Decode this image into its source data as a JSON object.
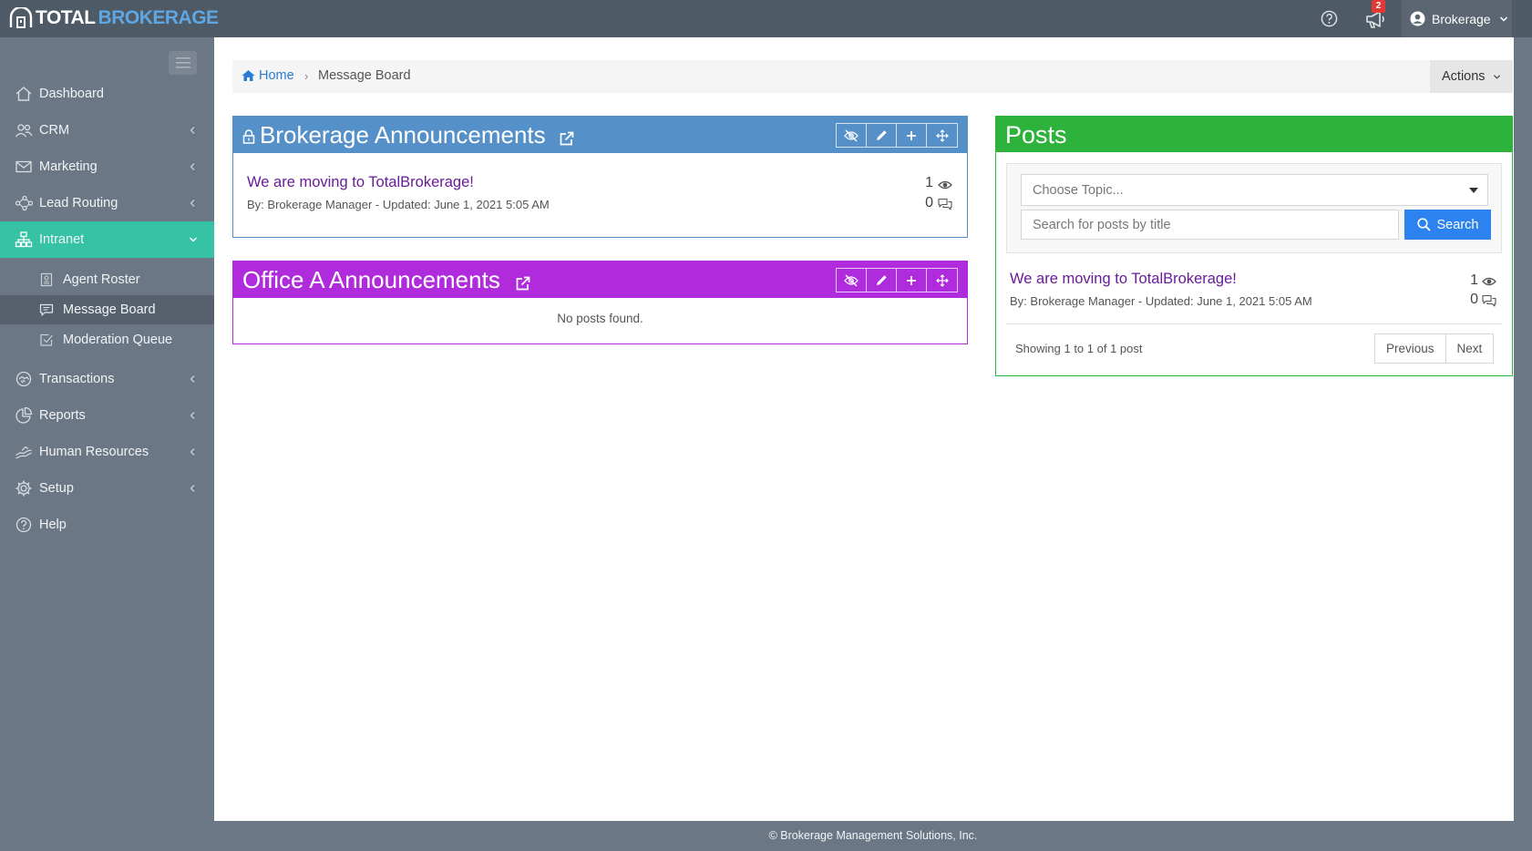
{
  "brand": {
    "part1": "TOTAL",
    "part2": "BROKERAGE"
  },
  "topbar": {
    "notification_count": "2",
    "user_label": "Brokerage"
  },
  "sidebar": {
    "items": [
      {
        "label": "Dashboard",
        "icon": "home-icon"
      },
      {
        "label": "CRM",
        "icon": "users-icon"
      },
      {
        "label": "Marketing",
        "icon": "envelope-icon"
      },
      {
        "label": "Lead Routing",
        "icon": "share-nodes-icon"
      },
      {
        "label": "Intranet",
        "icon": "sitemap-icon"
      },
      {
        "label": "Transactions",
        "icon": "handshake-icon"
      },
      {
        "label": "Reports",
        "icon": "pie-chart-icon"
      },
      {
        "label": "Human Resources",
        "icon": "hand-icon"
      },
      {
        "label": "Setup",
        "icon": "gear-icon"
      },
      {
        "label": "Help",
        "icon": "question-icon"
      }
    ],
    "subitems": [
      {
        "label": "Agent Roster",
        "icon": "id-card-icon"
      },
      {
        "label": "Message Board",
        "icon": "comment-icon"
      },
      {
        "label": "Moderation Queue",
        "icon": "check-square-icon"
      }
    ]
  },
  "breadcrumb": {
    "home": "Home",
    "current": "Message Board"
  },
  "actions_label": "Actions",
  "boards": [
    {
      "title": "Brokerage Announcements",
      "color": "#5590c8",
      "posts": [
        {
          "title": "We are moving to TotalBrokerage!",
          "meta": "By: Brokerage Manager - Updated: June 1, 2021 5:05 AM",
          "views": "1",
          "comments": "0"
        }
      ]
    },
    {
      "title": "Office A Announcements",
      "color": "#b02bdb",
      "empty_text": "No posts found."
    }
  ],
  "posts_panel": {
    "title": "Posts",
    "color": "#2db23c",
    "topic_placeholder": "Choose Topic...",
    "search_placeholder": "Search for posts by title",
    "search_label": "Search",
    "posts": [
      {
        "title": "We are moving to TotalBrokerage!",
        "meta": "By: Brokerage Manager - Updated: June 1, 2021 5:05 AM",
        "views": "1",
        "comments": "0"
      }
    ],
    "showing": "Showing 1 to 1 of 1 post",
    "prev_label": "Previous",
    "next_label": "Next"
  },
  "footer": "© Brokerage Management Solutions, Inc."
}
